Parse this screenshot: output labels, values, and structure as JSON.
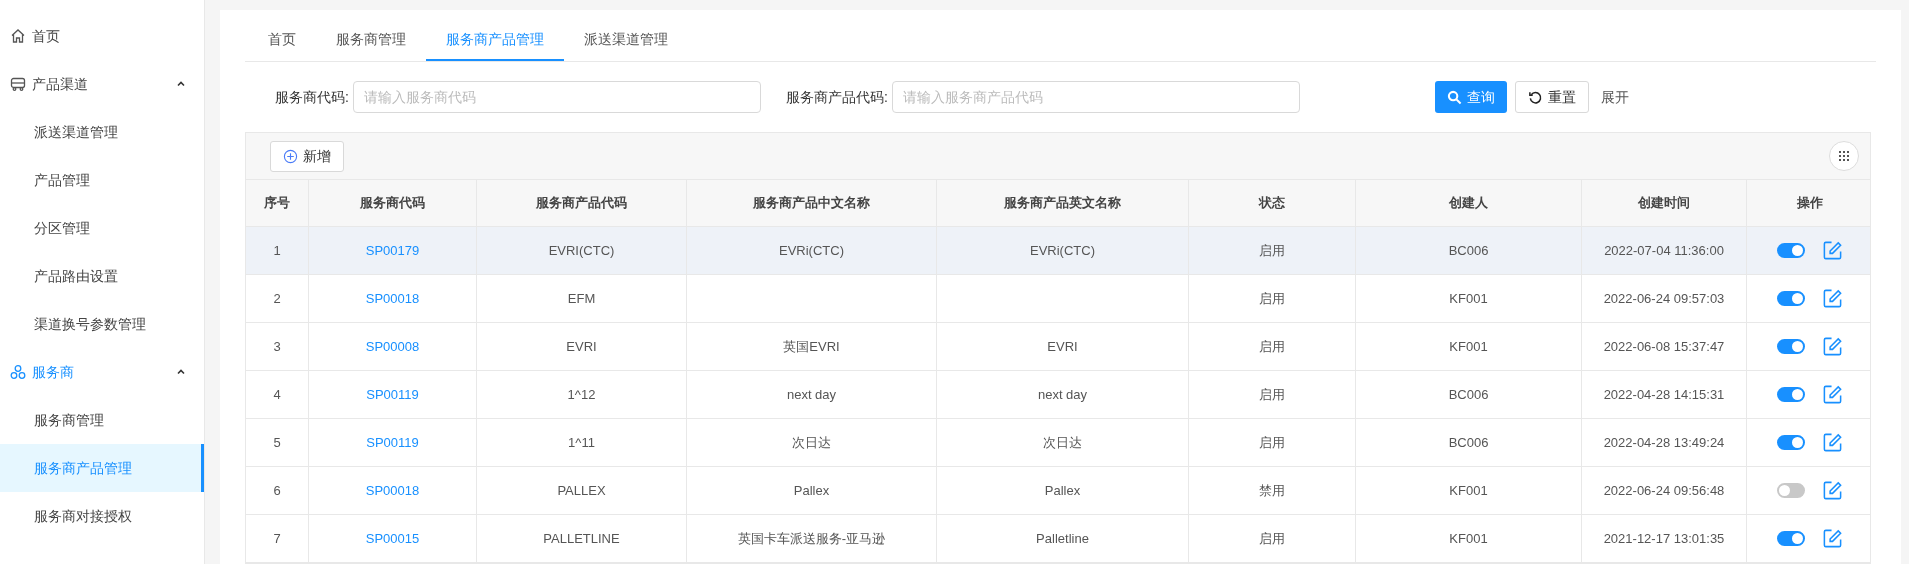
{
  "sidebar": {
    "items": [
      {
        "kind": "link",
        "label": "首页",
        "selected": false
      },
      {
        "kind": "group",
        "label": "产品渠道",
        "expanded": true,
        "selected": false,
        "children": [
          {
            "label": "派送渠道管理",
            "selected": false
          },
          {
            "label": "产品管理",
            "selected": false
          },
          {
            "label": "分区管理",
            "selected": false
          },
          {
            "label": "产品路由设置",
            "selected": false
          },
          {
            "label": "渠道换号参数管理",
            "selected": false
          }
        ]
      },
      {
        "kind": "group",
        "label": "服务商",
        "expanded": true,
        "selected": true,
        "children": [
          {
            "label": "服务商管理",
            "selected": false
          },
          {
            "label": "服务商产品管理",
            "selected": true
          },
          {
            "label": "服务商对接授权",
            "selected": false
          }
        ]
      }
    ]
  },
  "tabs": [
    {
      "label": "首页",
      "selected": false
    },
    {
      "label": "服务商管理",
      "selected": false
    },
    {
      "label": "服务商产品管理",
      "selected": true
    },
    {
      "label": "派送渠道管理",
      "selected": false
    }
  ],
  "filters": [
    {
      "label": "服务商代码:",
      "placeholder": "请输入服务商代码"
    },
    {
      "label": "服务商产品代码:",
      "placeholder": "请输入服务商产品代码"
    }
  ],
  "actions": {
    "search": "查询",
    "reset": "重置",
    "expand": "展开"
  },
  "toolbar": {
    "add": "新增"
  },
  "table": {
    "columns": [
      "序号",
      "服务商代码",
      "服务商产品代码",
      "服务商产品中文名称",
      "服务商产品英文名称",
      "状态",
      "创建人",
      "创建时间",
      "操作"
    ],
    "rows": [
      {
        "index": "1",
        "code": "SP00179",
        "product_code": "EVRI(CTC)",
        "name_cn": "EVRi(CTC)",
        "name_en": "EVRi(CTC)",
        "status": "启用",
        "creator": "BC006",
        "created": "2022-07-04 11:36:00",
        "on": true,
        "selected": true
      },
      {
        "index": "2",
        "code": "SP00018",
        "product_code": "EFM",
        "name_cn": "",
        "name_en": "",
        "status": "启用",
        "creator": "KF001",
        "created": "2022-06-24 09:57:03",
        "on": true,
        "selected": false
      },
      {
        "index": "3",
        "code": "SP00008",
        "product_code": "EVRI",
        "name_cn": "英国EVRI",
        "name_en": "EVRI",
        "status": "启用",
        "creator": "KF001",
        "created": "2022-06-08 15:37:47",
        "on": true,
        "selected": false
      },
      {
        "index": "4",
        "code": "SP00119",
        "product_code": "1^12",
        "name_cn": "next day",
        "name_en": "next day",
        "status": "启用",
        "creator": "BC006",
        "created": "2022-04-28 14:15:31",
        "on": true,
        "selected": false
      },
      {
        "index": "5",
        "code": "SP00119",
        "product_code": "1^11",
        "name_cn": "次日达",
        "name_en": "次日达",
        "status": "启用",
        "creator": "BC006",
        "created": "2022-04-28 13:49:24",
        "on": true,
        "selected": false
      },
      {
        "index": "6",
        "code": "SP00018",
        "product_code": "PALLEX",
        "name_cn": "Pallex",
        "name_en": "Pallex",
        "status": "禁用",
        "creator": "KF001",
        "created": "2022-06-24 09:56:48",
        "on": false,
        "selected": false
      },
      {
        "index": "7",
        "code": "SP00015",
        "product_code": "PALLETLINE",
        "name_cn": "英国卡车派送服务-亚马逊",
        "name_en": "Palletline",
        "status": "启用",
        "creator": "KF001",
        "created": "2021-12-17 13:01:35",
        "on": true,
        "selected": false
      }
    ]
  }
}
